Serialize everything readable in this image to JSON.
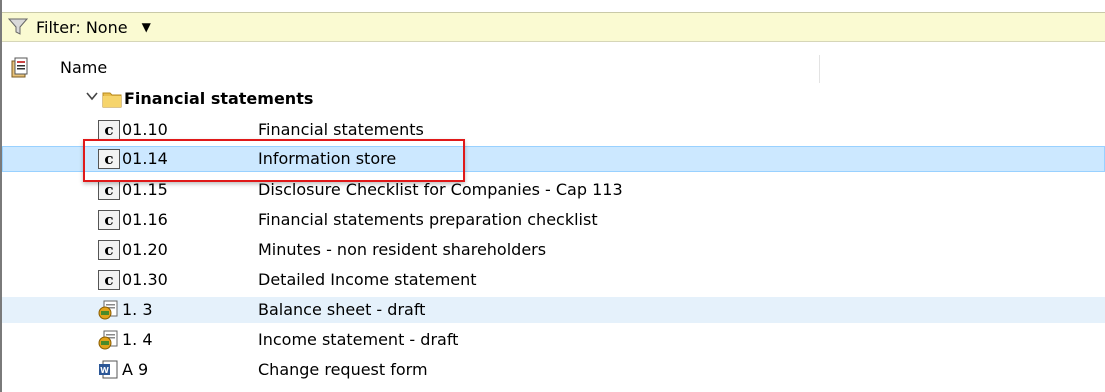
{
  "filter": {
    "label": "Filter: None",
    "icon": "filter-icon",
    "dropdown_icon": "chevron-down-icon"
  },
  "header": {
    "name_label": "Name",
    "icon": "document-icon"
  },
  "group": {
    "label": "Financial statements",
    "icon": "folder-icon",
    "expand_icon": "chevron-down-icon"
  },
  "items": [
    {
      "code": "01.10",
      "description": "Financial statements",
      "icon": "checklist-document-icon"
    },
    {
      "code": "01.14",
      "description": "Information store",
      "icon": "checklist-document-icon"
    },
    {
      "code": "01.15",
      "description": "Disclosure Checklist for Companies - Cap 113",
      "icon": "checklist-document-icon"
    },
    {
      "code": "01.16",
      "description": "Financial statements preparation checklist",
      "icon": "checklist-document-icon"
    },
    {
      "code": "01.20",
      "description": "Minutes - non resident shareholders",
      "icon": "checklist-document-icon"
    },
    {
      "code": "01.30",
      "description": "Detailed Income statement",
      "icon": "checklist-document-icon"
    },
    {
      "code": "1. 3",
      "description": "Balance sheet - draft",
      "icon": "spreadsheet-document-icon"
    },
    {
      "code": "1. 4",
      "description": "Income statement - draft",
      "icon": "spreadsheet-document-icon"
    },
    {
      "code": "A 9",
      "description": "Change request form",
      "icon": "word-document-icon"
    }
  ],
  "colors": {
    "filter_bar": "#fafad2",
    "selected_row": "#cce8ff",
    "alt_row": "#e5f1fb",
    "highlight_box": "#e01919"
  }
}
